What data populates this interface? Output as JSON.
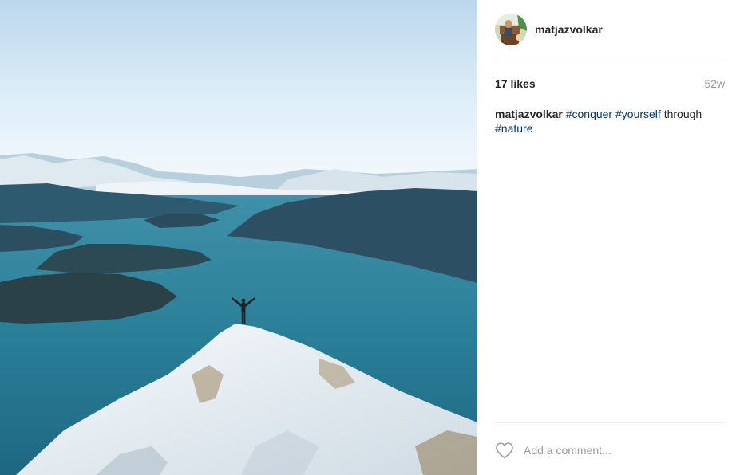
{
  "post": {
    "username": "matjazvolkar",
    "likes": "17 likes",
    "age": "52w",
    "caption": {
      "username": "matjazvolkar",
      "tags": [
        "#conquer",
        "#yourself"
      ],
      "text_through": "through",
      "tag_last": "#nature"
    },
    "comment": {
      "placeholder": "Add a comment..."
    },
    "icons": {
      "like": "heart-outline-icon"
    },
    "colors": {
      "hashtag": "#003569",
      "text": "#262626",
      "muted": "#999999"
    }
  }
}
